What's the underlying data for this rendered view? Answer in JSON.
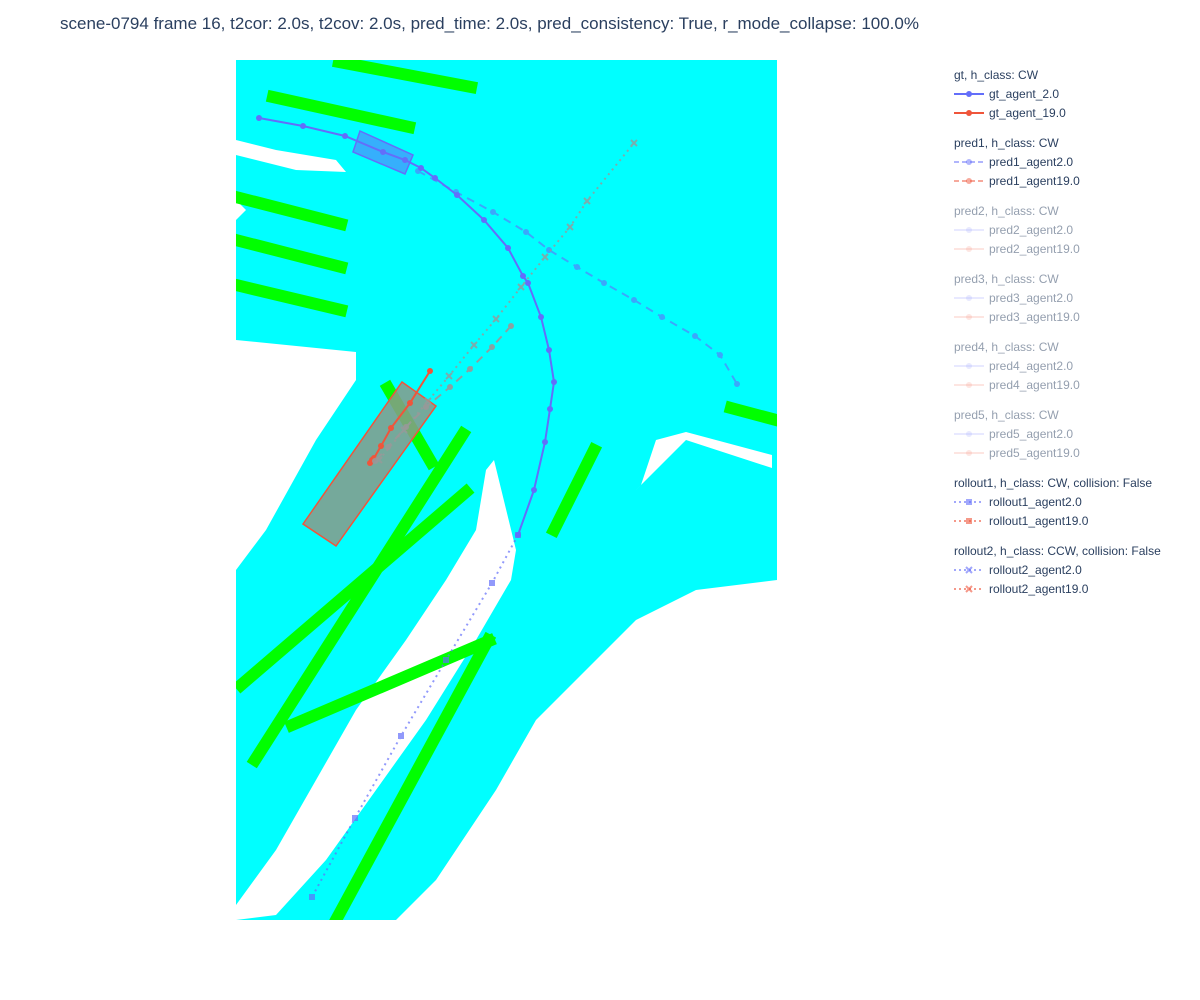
{
  "title": "scene-0794 frame 16, t2cor: 2.0s, t2cov: 2.0s, pred_time: 2.0s, pred_consistency: True, r_mode_collapse: 100.0%",
  "colors": {
    "drivable": "#00ffff",
    "lane": "#00ff00",
    "background": "#ffffff",
    "agent_2": "#636efa",
    "agent_19": "#ef553b",
    "gray": "#999999"
  },
  "chart_data": {
    "type": "scatter",
    "title": "scene-0794 frame 16, t2cor: 2.0s, t2cov: 2.0s, pred_time: 2.0s, pred_consistency: True, r_mode_collapse: 100.0%",
    "xlabel": "",
    "ylabel": "",
    "xlim": [
      0,
      540
    ],
    "ylim": [
      0,
      860
    ],
    "grid": false,
    "legend_placement": "right",
    "series": [
      {
        "name": "gt_agent_2.0",
        "group": "gt",
        "color": "#636efa",
        "dash": "solid",
        "marker": "circle",
        "opacity": 1,
        "x": [
          23,
          67,
          109,
          147,
          169,
          185,
          199,
          221,
          248,
          272,
          287,
          292,
          305,
          313,
          318,
          314,
          309,
          298,
          282
        ],
        "y": [
          802,
          794,
          784,
          768,
          760,
          752,
          742,
          725,
          700,
          672,
          644,
          637,
          603,
          570,
          538,
          511,
          478,
          430,
          385
        ]
      },
      {
        "name": "gt_agent_19.0",
        "group": "gt",
        "color": "#ef553b",
        "dash": "solid",
        "marker": "circle",
        "opacity": 1,
        "x": [
          194,
          174,
          155,
          145,
          138,
          134,
          136
        ],
        "y": [
          549,
          517,
          492,
          474,
          462,
          457,
          460
        ]
      },
      {
        "name": "pred1_agent2.0",
        "group": "pred1",
        "color": "#636efa",
        "dash": "dash",
        "marker": "circle",
        "opacity": 0.6,
        "x": [
          182,
          220,
          257,
          290,
          313,
          341,
          368,
          398,
          426,
          459,
          484,
          501
        ],
        "y": [
          749,
          728,
          708,
          688,
          670,
          653,
          637,
          620,
          603,
          584,
          565,
          536
        ]
      },
      {
        "name": "pred1_agent19.0",
        "group": "pred1",
        "color": "#999999",
        "dash": "dash",
        "marker": "circle",
        "opacity": 0.9,
        "x": [
          275,
          256,
          234,
          214,
          190,
          170,
          152,
          139
        ],
        "y": [
          594,
          573,
          551,
          533,
          513,
          493,
          473,
          459
        ]
      },
      {
        "name": "pred2_agent2.0",
        "group": "pred2",
        "color": "#636efa",
        "dash": "solid",
        "marker": "circle",
        "opacity": 0.2,
        "x": [],
        "y": []
      },
      {
        "name": "pred2_agent19.0",
        "group": "pred2",
        "color": "#ef553b",
        "dash": "solid",
        "marker": "circle",
        "opacity": 0.2,
        "x": [],
        "y": []
      },
      {
        "name": "pred3_agent2.0",
        "group": "pred3",
        "color": "#636efa",
        "dash": "solid",
        "marker": "circle",
        "opacity": 0.2,
        "x": [],
        "y": []
      },
      {
        "name": "pred3_agent19.0",
        "group": "pred3",
        "color": "#ef553b",
        "dash": "solid",
        "marker": "circle",
        "opacity": 0.2,
        "x": [],
        "y": []
      },
      {
        "name": "pred4_agent2.0",
        "group": "pred4",
        "color": "#636efa",
        "dash": "solid",
        "marker": "circle",
        "opacity": 0.2,
        "x": [],
        "y": []
      },
      {
        "name": "pred4_agent19.0",
        "group": "pred4",
        "color": "#ef553b",
        "dash": "solid",
        "marker": "circle",
        "opacity": 0.2,
        "x": [],
        "y": []
      },
      {
        "name": "pred5_agent2.0",
        "group": "pred5",
        "color": "#636efa",
        "dash": "solid",
        "marker": "circle",
        "opacity": 0.2,
        "x": [],
        "y": []
      },
      {
        "name": "pred5_agent19.0",
        "group": "pred5",
        "color": "#ef553b",
        "dash": "solid",
        "marker": "circle",
        "opacity": 0.2,
        "x": [],
        "y": []
      },
      {
        "name": "rollout1_agent2.0",
        "group": "rollout1",
        "color": "#636efa",
        "dash": "dot",
        "marker": "square",
        "opacity": 0.7,
        "x": [
          282,
          256,
          210,
          165,
          119,
          76
        ],
        "y": [
          385,
          337,
          260,
          184,
          102,
          23
        ]
      },
      {
        "name": "rollout1_agent19.0",
        "group": "rollout1",
        "color": "#ef553b",
        "dash": "dot",
        "marker": "square",
        "opacity": 0.5,
        "x": [],
        "y": []
      },
      {
        "name": "rollout2_agent2.0",
        "group": "rollout2",
        "color": "#636efa",
        "dash": "dot",
        "marker": "x",
        "opacity": 0.7,
        "x": [],
        "y": []
      },
      {
        "name": "rollout2_agent19.0",
        "group": "rollout2",
        "color": "#999999",
        "dash": "dot",
        "marker": "x",
        "opacity": 0.8,
        "x": [
          143,
          168,
          192,
          213,
          238,
          260,
          285,
          309,
          334,
          351,
          398
        ],
        "y": [
          460,
          490,
          519,
          544,
          575,
          601,
          633,
          663,
          693,
          719,
          777
        ]
      }
    ],
    "agent_boxes": [
      {
        "agent": "2.0",
        "color": "#636efa",
        "corners_x": [
          124,
          177,
          169,
          117
        ],
        "corners_y": [
          789,
          765,
          746,
          768
        ]
      },
      {
        "agent": "19.0",
        "color": "#ef553b",
        "corners_x": [
          166,
          200,
          100,
          67
        ],
        "corners_y": [
          538,
          514,
          374,
          396
        ]
      }
    ],
    "lane_strips": [
      {
        "x": [
          103,
          235
        ],
        "y": [
          858,
          833
        ]
      },
      {
        "x": [
          37,
          173
        ],
        "y": [
          823,
          793
        ]
      },
      {
        "x": [
          0,
          105
        ],
        "y": [
          723,
          696
        ]
      },
      {
        "x": [
          0,
          105
        ],
        "y": [
          680,
          653
        ]
      },
      {
        "x": [
          0,
          105
        ],
        "y": [
          635,
          610
        ]
      },
      {
        "x": [
          152,
          195
        ],
        "y": [
          532,
          458
        ]
      },
      {
        "x": [
          5,
          230
        ],
        "y": [
          235,
          428
        ]
      },
      {
        "x": [
          19,
          227
        ],
        "y": [
          160,
          486
        ]
      },
      {
        "x": [
          56,
          253
        ],
        "y": [
          195,
          279
        ]
      },
      {
        "x": [
          100,
          252
        ],
        "y": [
          0,
          280
        ]
      },
      {
        "x": [
          318,
          358
        ],
        "y": [
          390,
          470
        ]
      },
      {
        "x": [
          495,
          540
        ],
        "y": [
          512,
          500
        ]
      }
    ],
    "groups": [
      {
        "title": "gt, h_class: CW",
        "opacity": 1,
        "items": [
          {
            "label": "gt_agent_2.0",
            "color": "#636efa",
            "dash": "solid",
            "marker": "circle"
          },
          {
            "label": "gt_agent_19.0",
            "color": "#ef553b",
            "dash": "solid",
            "marker": "circle"
          }
        ]
      },
      {
        "title": "pred1, h_class: CW",
        "opacity": 1,
        "items": [
          {
            "label": "pred1_agent2.0",
            "color": "#636efa",
            "dash": "dash",
            "marker": "circle",
            "op": 0.5
          },
          {
            "label": "pred1_agent19.0",
            "color": "#ef553b",
            "dash": "dash",
            "marker": "circle",
            "op": 0.5
          }
        ]
      },
      {
        "title": "pred2, h_class: CW",
        "opacity": 0.5,
        "items": [
          {
            "label": "pred2_agent2.0",
            "color": "#636efa",
            "dash": "solid",
            "marker": "circle",
            "op": 0.3
          },
          {
            "label": "pred2_agent19.0",
            "color": "#ef553b",
            "dash": "solid",
            "marker": "circle",
            "op": 0.3
          }
        ]
      },
      {
        "title": "pred3, h_class: CW",
        "opacity": 0.5,
        "items": [
          {
            "label": "pred3_agent2.0",
            "color": "#636efa",
            "dash": "solid",
            "marker": "circle",
            "op": 0.3
          },
          {
            "label": "pred3_agent19.0",
            "color": "#ef553b",
            "dash": "solid",
            "marker": "circle",
            "op": 0.3
          }
        ]
      },
      {
        "title": "pred4, h_class: CW",
        "opacity": 0.5,
        "items": [
          {
            "label": "pred4_agent2.0",
            "color": "#636efa",
            "dash": "solid",
            "marker": "circle",
            "op": 0.3
          },
          {
            "label": "pred4_agent19.0",
            "color": "#ef553b",
            "dash": "solid",
            "marker": "circle",
            "op": 0.3
          }
        ]
      },
      {
        "title": "pred5, h_class: CW",
        "opacity": 0.5,
        "items": [
          {
            "label": "pred5_agent2.0",
            "color": "#636efa",
            "dash": "solid",
            "marker": "circle",
            "op": 0.3
          },
          {
            "label": "pred5_agent19.0",
            "color": "#ef553b",
            "dash": "solid",
            "marker": "circle",
            "op": 0.3
          }
        ]
      },
      {
        "title": "rollout1, h_class: CW, collision: False",
        "opacity": 1,
        "items": [
          {
            "label": "rollout1_agent2.0",
            "color": "#636efa",
            "dash": "dot",
            "marker": "square",
            "op": 0.6
          },
          {
            "label": "rollout1_agent19.0",
            "color": "#ef553b",
            "dash": "dot",
            "marker": "square",
            "op": 0.6
          }
        ]
      },
      {
        "title": "rollout2, h_class: CCW, collision: False",
        "opacity": 1,
        "items": [
          {
            "label": "rollout2_agent2.0",
            "color": "#636efa",
            "dash": "dot",
            "marker": "x",
            "op": 0.6
          },
          {
            "label": "rollout2_agent19.0",
            "color": "#ef553b",
            "dash": "dot",
            "marker": "x",
            "op": 0.6
          }
        ]
      }
    ]
  }
}
